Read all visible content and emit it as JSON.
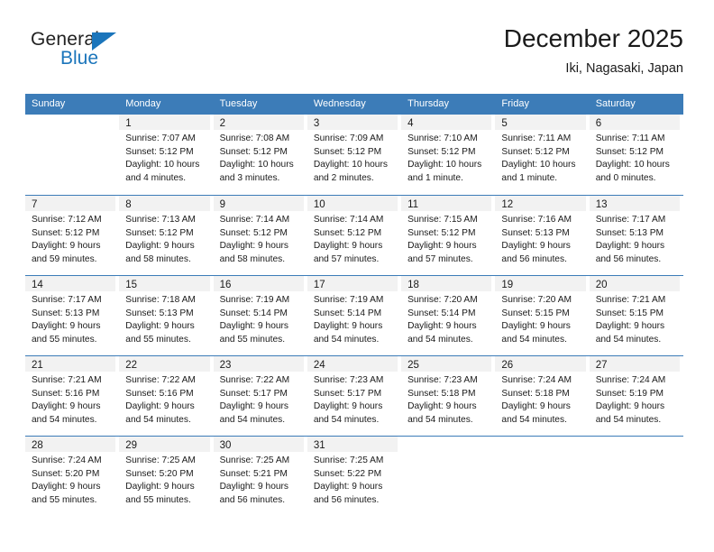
{
  "brand": {
    "name_top": "General",
    "name_bottom": "Blue",
    "accent_color": "#1b75bb"
  },
  "header": {
    "title": "December 2025",
    "subtitle": "Iki, Nagasaki, Japan"
  },
  "theme": {
    "header_bar_color": "#3c7cb8",
    "daynum_band_color": "#f2f2f2",
    "text_color": "#1a1a1a"
  },
  "weekdays": [
    "Sunday",
    "Monday",
    "Tuesday",
    "Wednesday",
    "Thursday",
    "Friday",
    "Saturday"
  ],
  "weeks": [
    [
      {
        "day": "",
        "lines": []
      },
      {
        "day": "1",
        "lines": [
          "Sunrise: 7:07 AM",
          "Sunset: 5:12 PM",
          "Daylight: 10 hours",
          "and 4 minutes."
        ]
      },
      {
        "day": "2",
        "lines": [
          "Sunrise: 7:08 AM",
          "Sunset: 5:12 PM",
          "Daylight: 10 hours",
          "and 3 minutes."
        ]
      },
      {
        "day": "3",
        "lines": [
          "Sunrise: 7:09 AM",
          "Sunset: 5:12 PM",
          "Daylight: 10 hours",
          "and 2 minutes."
        ]
      },
      {
        "day": "4",
        "lines": [
          "Sunrise: 7:10 AM",
          "Sunset: 5:12 PM",
          "Daylight: 10 hours",
          "and 1 minute."
        ]
      },
      {
        "day": "5",
        "lines": [
          "Sunrise: 7:11 AM",
          "Sunset: 5:12 PM",
          "Daylight: 10 hours",
          "and 1 minute."
        ]
      },
      {
        "day": "6",
        "lines": [
          "Sunrise: 7:11 AM",
          "Sunset: 5:12 PM",
          "Daylight: 10 hours",
          "and 0 minutes."
        ]
      }
    ],
    [
      {
        "day": "7",
        "lines": [
          "Sunrise: 7:12 AM",
          "Sunset: 5:12 PM",
          "Daylight: 9 hours",
          "and 59 minutes."
        ]
      },
      {
        "day": "8",
        "lines": [
          "Sunrise: 7:13 AM",
          "Sunset: 5:12 PM",
          "Daylight: 9 hours",
          "and 58 minutes."
        ]
      },
      {
        "day": "9",
        "lines": [
          "Sunrise: 7:14 AM",
          "Sunset: 5:12 PM",
          "Daylight: 9 hours",
          "and 58 minutes."
        ]
      },
      {
        "day": "10",
        "lines": [
          "Sunrise: 7:14 AM",
          "Sunset: 5:12 PM",
          "Daylight: 9 hours",
          "and 57 minutes."
        ]
      },
      {
        "day": "11",
        "lines": [
          "Sunrise: 7:15 AM",
          "Sunset: 5:12 PM",
          "Daylight: 9 hours",
          "and 57 minutes."
        ]
      },
      {
        "day": "12",
        "lines": [
          "Sunrise: 7:16 AM",
          "Sunset: 5:13 PM",
          "Daylight: 9 hours",
          "and 56 minutes."
        ]
      },
      {
        "day": "13",
        "lines": [
          "Sunrise: 7:17 AM",
          "Sunset: 5:13 PM",
          "Daylight: 9 hours",
          "and 56 minutes."
        ]
      }
    ],
    [
      {
        "day": "14",
        "lines": [
          "Sunrise: 7:17 AM",
          "Sunset: 5:13 PM",
          "Daylight: 9 hours",
          "and 55 minutes."
        ]
      },
      {
        "day": "15",
        "lines": [
          "Sunrise: 7:18 AM",
          "Sunset: 5:13 PM",
          "Daylight: 9 hours",
          "and 55 minutes."
        ]
      },
      {
        "day": "16",
        "lines": [
          "Sunrise: 7:19 AM",
          "Sunset: 5:14 PM",
          "Daylight: 9 hours",
          "and 55 minutes."
        ]
      },
      {
        "day": "17",
        "lines": [
          "Sunrise: 7:19 AM",
          "Sunset: 5:14 PM",
          "Daylight: 9 hours",
          "and 54 minutes."
        ]
      },
      {
        "day": "18",
        "lines": [
          "Sunrise: 7:20 AM",
          "Sunset: 5:14 PM",
          "Daylight: 9 hours",
          "and 54 minutes."
        ]
      },
      {
        "day": "19",
        "lines": [
          "Sunrise: 7:20 AM",
          "Sunset: 5:15 PM",
          "Daylight: 9 hours",
          "and 54 minutes."
        ]
      },
      {
        "day": "20",
        "lines": [
          "Sunrise: 7:21 AM",
          "Sunset: 5:15 PM",
          "Daylight: 9 hours",
          "and 54 minutes."
        ]
      }
    ],
    [
      {
        "day": "21",
        "lines": [
          "Sunrise: 7:21 AM",
          "Sunset: 5:16 PM",
          "Daylight: 9 hours",
          "and 54 minutes."
        ]
      },
      {
        "day": "22",
        "lines": [
          "Sunrise: 7:22 AM",
          "Sunset: 5:16 PM",
          "Daylight: 9 hours",
          "and 54 minutes."
        ]
      },
      {
        "day": "23",
        "lines": [
          "Sunrise: 7:22 AM",
          "Sunset: 5:17 PM",
          "Daylight: 9 hours",
          "and 54 minutes."
        ]
      },
      {
        "day": "24",
        "lines": [
          "Sunrise: 7:23 AM",
          "Sunset: 5:17 PM",
          "Daylight: 9 hours",
          "and 54 minutes."
        ]
      },
      {
        "day": "25",
        "lines": [
          "Sunrise: 7:23 AM",
          "Sunset: 5:18 PM",
          "Daylight: 9 hours",
          "and 54 minutes."
        ]
      },
      {
        "day": "26",
        "lines": [
          "Sunrise: 7:24 AM",
          "Sunset: 5:18 PM",
          "Daylight: 9 hours",
          "and 54 minutes."
        ]
      },
      {
        "day": "27",
        "lines": [
          "Sunrise: 7:24 AM",
          "Sunset: 5:19 PM",
          "Daylight: 9 hours",
          "and 54 minutes."
        ]
      }
    ],
    [
      {
        "day": "28",
        "lines": [
          "Sunrise: 7:24 AM",
          "Sunset: 5:20 PM",
          "Daylight: 9 hours",
          "and 55 minutes."
        ]
      },
      {
        "day": "29",
        "lines": [
          "Sunrise: 7:25 AM",
          "Sunset: 5:20 PM",
          "Daylight: 9 hours",
          "and 55 minutes."
        ]
      },
      {
        "day": "30",
        "lines": [
          "Sunrise: 7:25 AM",
          "Sunset: 5:21 PM",
          "Daylight: 9 hours",
          "and 56 minutes."
        ]
      },
      {
        "day": "31",
        "lines": [
          "Sunrise: 7:25 AM",
          "Sunset: 5:22 PM",
          "Daylight: 9 hours",
          "and 56 minutes."
        ]
      },
      {
        "day": "",
        "lines": []
      },
      {
        "day": "",
        "lines": []
      },
      {
        "day": "",
        "lines": []
      }
    ]
  ]
}
